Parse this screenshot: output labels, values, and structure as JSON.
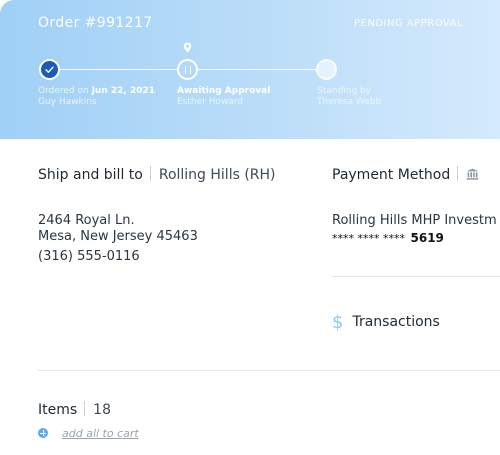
{
  "colors": {
    "accent": "#1e5bb8",
    "header_gradient_start": "#9fd0f6",
    "header_gradient_end": "#d5eafd"
  },
  "header": {
    "order_title": "Order #991217",
    "status": "PENDING APPROVAL",
    "steps": [
      {
        "prefix": "Ordered on",
        "date": "Jun 22, 2021",
        "person": "Guy Hawkins",
        "state": "done",
        "icon": "check-icon"
      },
      {
        "label": "Awaiting Approval",
        "person": "Esther Howard",
        "state": "active",
        "icon": "pause-icon"
      },
      {
        "label": "Standing by",
        "person": "Theresa Webb",
        "state": "pending"
      }
    ]
  },
  "ship": {
    "title": "Ship and bill to",
    "location": "Rolling Hills (RH)",
    "address_line1": "2464 Royal Ln.",
    "address_line2": "Mesa, New Jersey 45463",
    "phone": "(316) 555-0116"
  },
  "payment": {
    "title": "Payment Method",
    "icon": "bank-icon",
    "account_name": "Rolling Hills MHP Investm",
    "card_masked": "**** **** ****",
    "card_last4": "5619"
  },
  "transactions": {
    "label": "Transactions",
    "icon": "dollar-icon"
  },
  "items": {
    "title": "Items",
    "count": "18",
    "add_all_label": "add all to cart"
  }
}
